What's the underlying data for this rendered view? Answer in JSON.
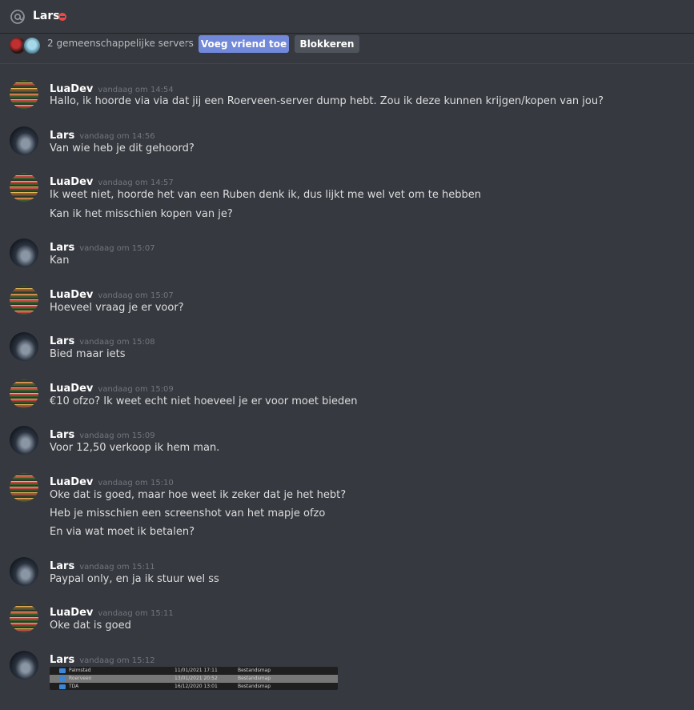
{
  "header": {
    "username": "Lars",
    "icon": "at-sign-icon",
    "status_icon": "dnd-icon"
  },
  "profile_bar": {
    "mutual_servers": "2 gemeenschappelijke servers",
    "add_friend": "Voeg vriend toe",
    "block": "Blokkeren",
    "colors": {
      "add_friend": "#7289da",
      "block": "#4f545c"
    }
  },
  "messages": [
    {
      "author": "LuaDev",
      "timestamp": "vandaag om 14:54",
      "lines": [
        "Hallo, ik hoorde via via dat jij een Roerveen-server dump hebt. Zou ik deze kunnen krijgen/kopen van jou?"
      ]
    },
    {
      "author": "Lars",
      "timestamp": "vandaag om 14:56",
      "lines": [
        "Van wie heb je dit gehoord?"
      ]
    },
    {
      "author": "LuaDev",
      "timestamp": "vandaag om 14:57",
      "lines": [
        "Ik weet niet, hoorde het van een Ruben denk ik, dus lijkt me wel vet om te hebben",
        "Kan ik het misschien kopen van je?"
      ]
    },
    {
      "author": "Lars",
      "timestamp": "vandaag om 15:07",
      "lines": [
        "Kan"
      ]
    },
    {
      "author": "LuaDev",
      "timestamp": "vandaag om 15:07",
      "lines": [
        "Hoeveel vraag je er voor?"
      ]
    },
    {
      "author": "Lars",
      "timestamp": "vandaag om 15:08",
      "lines": [
        "Bied maar iets"
      ]
    },
    {
      "author": "LuaDev",
      "timestamp": "vandaag om 15:09",
      "lines": [
        "€10 ofzo? Ik weet echt niet hoeveel je er voor moet bieden"
      ]
    },
    {
      "author": "Lars",
      "timestamp": "vandaag om 15:09",
      "lines": [
        "Voor 12,50 verkoop ik hem man."
      ]
    },
    {
      "author": "LuaDev",
      "timestamp": "vandaag om 15:10",
      "lines": [
        "Oke dat is goed, maar hoe weet ik zeker dat je het hebt?",
        "Heb je misschien een screenshot van het mapje ofzo",
        "En via wat moet ik betalen?"
      ]
    },
    {
      "author": "Lars",
      "timestamp": "vandaag om 15:11",
      "lines": [
        "Paypal only, en ja ik stuur wel ss"
      ]
    },
    {
      "author": "LuaDev",
      "timestamp": "vandaag om 15:11",
      "lines": [
        "Oke dat is goed"
      ]
    },
    {
      "author": "Lars",
      "timestamp": "vandaag om 15:12",
      "lines": []
    }
  ],
  "attachment": {
    "rows": [
      {
        "name": "Palmstad",
        "date": "11/01/2021 17:11",
        "type": "Bestandsmap"
      },
      {
        "name": "Roerveen",
        "date": "13/01/2021 20:52",
        "type": "Bestandsmap"
      },
      {
        "name": "TDA",
        "date": "16/12/2020 13:01",
        "type": "Bestandsmap"
      }
    ]
  }
}
